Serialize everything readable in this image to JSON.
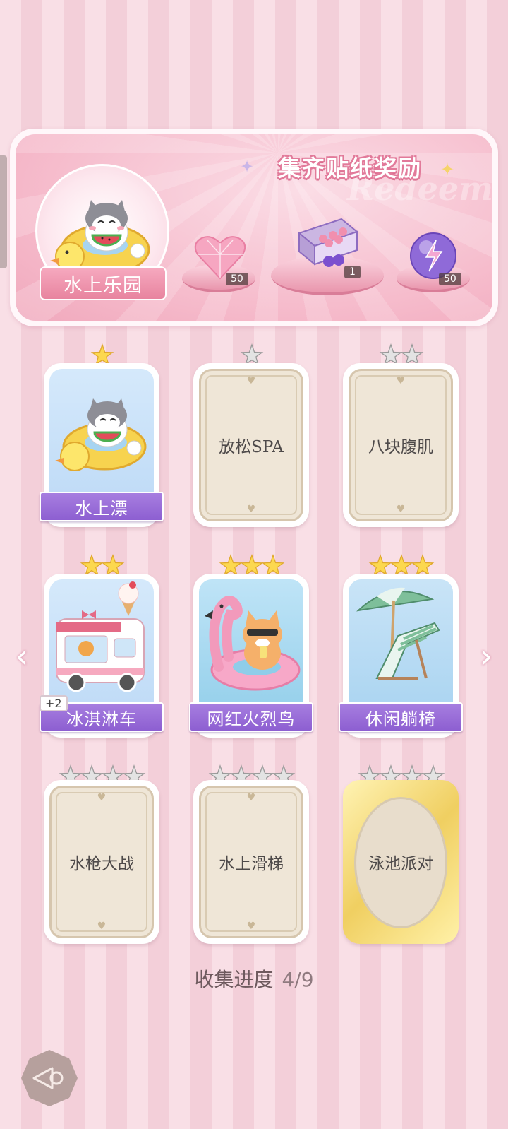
{
  "banner": {
    "title": "集齐贴纸奖励",
    "watermark": "Redeem",
    "place_name": "水上乐园",
    "rewards": [
      {
        "icon": "pink-heart-gem-icon",
        "count": "50"
      },
      {
        "icon": "gift-box-icon",
        "count": "1"
      },
      {
        "icon": "purple-energy-orb-icon",
        "count": "50"
      }
    ]
  },
  "stickers": [
    {
      "name": "水上漂",
      "stars": 1,
      "unlocked": true,
      "art": "cat-on-duck-float"
    },
    {
      "name": "放松SPA",
      "stars": 1,
      "unlocked": false
    },
    {
      "name": "八块腹肌",
      "stars": 2,
      "unlocked": false
    },
    {
      "name": "冰淇淋车",
      "stars": 2,
      "unlocked": true,
      "art": "ice-cream-truck",
      "extra_badge": "+2"
    },
    {
      "name": "网红火烈鸟",
      "stars": 3,
      "unlocked": true,
      "art": "cat-on-flamingo-float"
    },
    {
      "name": "休闲躺椅",
      "stars": 3,
      "unlocked": true,
      "art": "beach-chair-umbrella"
    },
    {
      "name": "水枪大战",
      "stars": 4,
      "unlocked": false
    },
    {
      "name": "水上滑梯",
      "stars": 4,
      "unlocked": false
    },
    {
      "name": "泳池派对",
      "stars": 4,
      "unlocked": false,
      "gold": true
    }
  ],
  "progress": {
    "label": "收集进度",
    "value": "4/9"
  },
  "nav": {
    "prev_icon": "chevron-left-icon",
    "next_icon": "chevron-right-icon",
    "back_icon": "back-arrow-icon"
  }
}
